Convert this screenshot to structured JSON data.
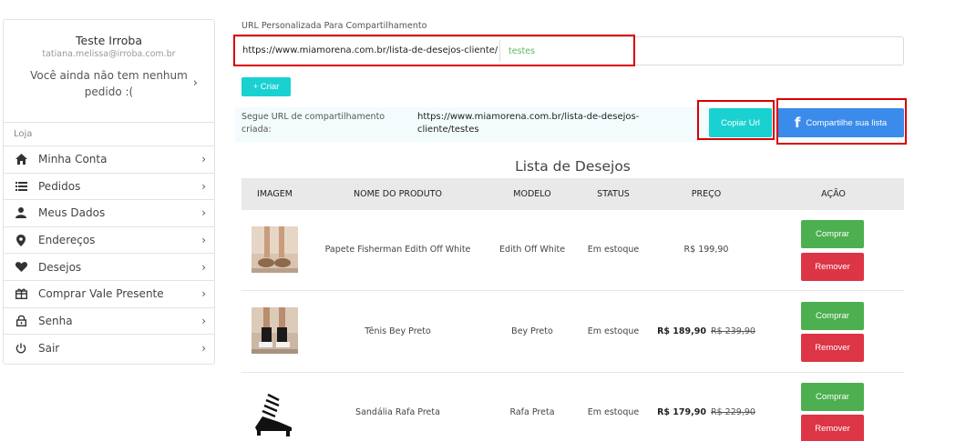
{
  "profile": {
    "name": "Teste Irroba",
    "email": "tatiana.melissa@irroba.com.br",
    "orders_message": "Você ainda não tem nenhum pedido :("
  },
  "sidebar": {
    "section_label": "Loja",
    "items": [
      {
        "label": "Minha Conta",
        "icon": "home-icon"
      },
      {
        "label": "Pedidos",
        "icon": "list-icon"
      },
      {
        "label": "Meus Dados",
        "icon": "user-icon"
      },
      {
        "label": "Endereços",
        "icon": "map-pin-icon"
      },
      {
        "label": "Desejos",
        "icon": "heart-icon"
      },
      {
        "label": "Comprar Vale Presente",
        "icon": "gift-icon"
      },
      {
        "label": "Senha",
        "icon": "lock-icon"
      },
      {
        "label": "Sair",
        "icon": "power-icon"
      }
    ]
  },
  "share_form": {
    "label": "URL Personalizada Para Compartilhamento",
    "url_prefix": "https://www.miamorena.com.br/lista-de-desejos-cliente/",
    "url_value": "testes",
    "create_button": "+ Criar",
    "created_label": "Segue URL de compartilhamento criada:",
    "created_url": "https://www.miamorena.com.br/lista-de-desejos-cliente/testes",
    "copy_button": "Copiar Url",
    "share_button": "Compartilhe sua lista"
  },
  "wishlist": {
    "title": "Lista de Desejos",
    "columns": [
      "IMAGEM",
      "NOME DO PRODUTO",
      "MODELO",
      "STATUS",
      "PREÇO",
      "AÇÃO"
    ],
    "buy_label": "Comprar",
    "remove_label": "Remover",
    "rows": [
      {
        "name": "Papete Fisherman Edith Off White",
        "model": "Edith Off White",
        "status": "Em estoque",
        "price": "R$ 199,90",
        "old_price": ""
      },
      {
        "name": "Tênis Bey Preto",
        "model": "Bey Preto",
        "status": "Em estoque",
        "price": "R$ 189,90",
        "old_price": "R$ 239,90"
      },
      {
        "name": "Sandália Rafa Preta",
        "model": "Rafa Preta",
        "status": "Em estoque",
        "price": "R$ 179,90",
        "old_price": "R$ 229,90"
      }
    ]
  },
  "colors": {
    "accent_cyan": "#1ad1d1",
    "facebook_blue": "#3b8bea",
    "buy_green": "#4caf50",
    "remove_red": "#dc3545",
    "highlight_red": "#d90000"
  }
}
